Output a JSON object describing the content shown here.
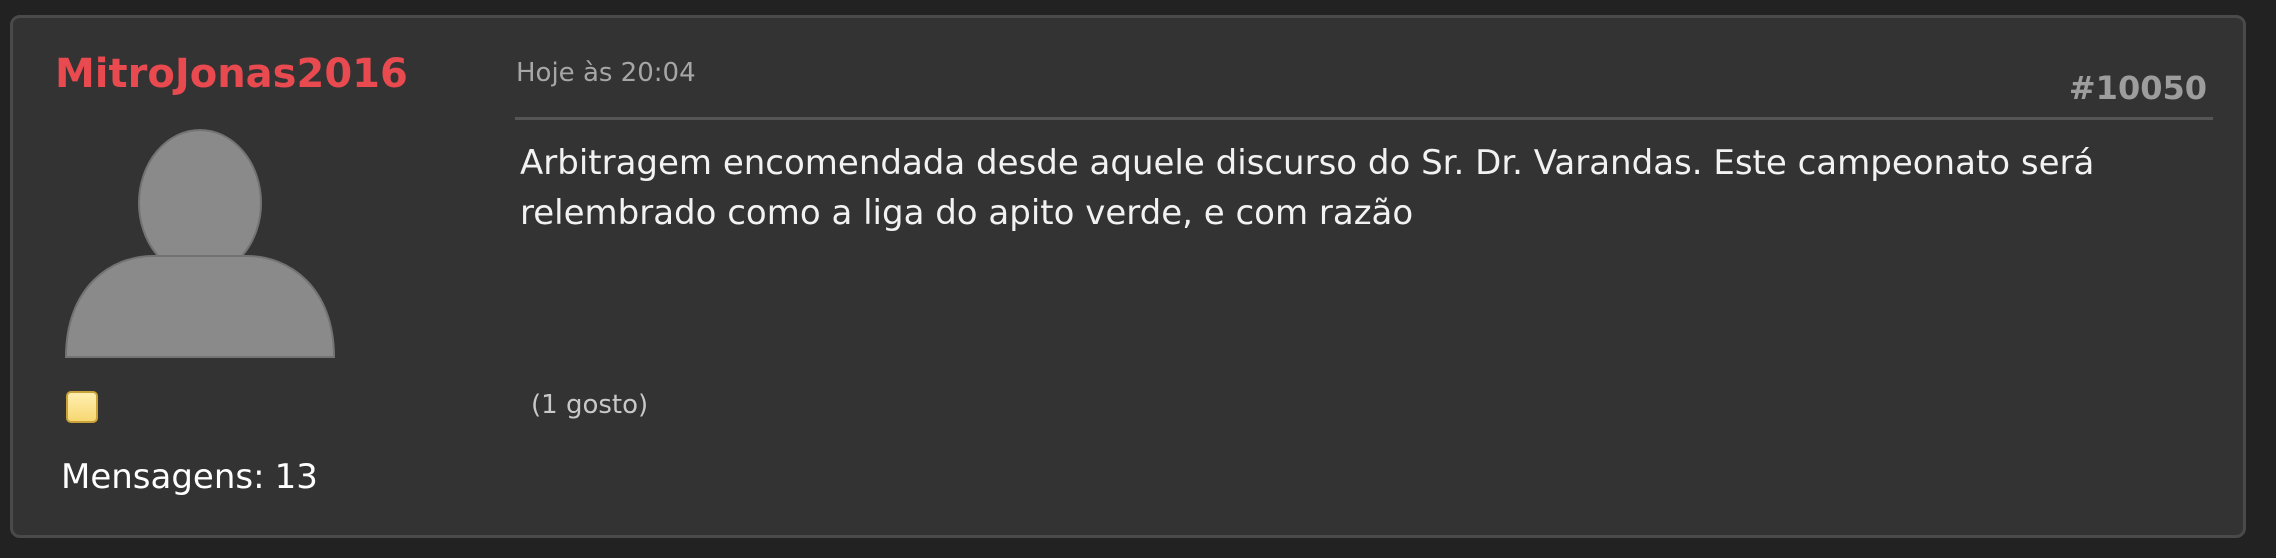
{
  "post": {
    "author": "MitroJonas2016",
    "timestamp": "Hoje às 20:04",
    "number": "#10050",
    "content": "Arbitragem encomendada desde aquele discurso do Sr. Dr. Varandas. Este campeonato será relembrado como a liga do apito verde, e com razão",
    "likes": "(1 gosto)"
  },
  "user": {
    "messages_label": "Mensagens:",
    "messages_count": "13",
    "avatar_icon": "default-user-avatar-icon",
    "rank_icon": "rank-badge-icon"
  },
  "colors": {
    "page_bg": "#222222",
    "card_bg": "#333333",
    "author": "#e84a4f",
    "muted_text": "#a6a6a6",
    "body_text": "#f2f2f2"
  }
}
